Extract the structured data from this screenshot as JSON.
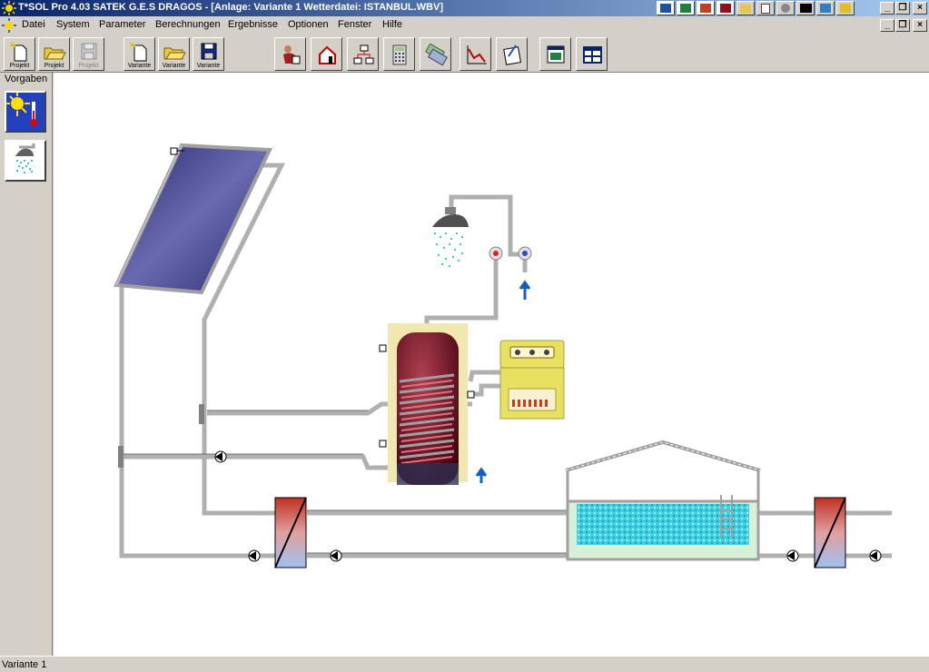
{
  "window": {
    "title": "T*SOL Pro 4.03 SATEK G.E.S DRAGOS - [Anlage: Variante 1    Wetterdatei: ISTANBUL.WBV]"
  },
  "menu": [
    {
      "label": "Datei"
    },
    {
      "label": "System"
    },
    {
      "label": "Parameter"
    },
    {
      "label": "Berechnungen"
    },
    {
      "label": "Ergebnisse"
    },
    {
      "label": "Optionen"
    },
    {
      "label": "Fenster"
    },
    {
      "label": "Hilfe"
    }
  ],
  "toolbar": {
    "new_project": "Projekt",
    "open_project": "Projekt",
    "save_project": "Projekt",
    "new_variant": "Variante",
    "open_variant": "Variante",
    "save_variant": "Variante"
  },
  "sidepanel": {
    "title": "Vorgaben"
  },
  "status": {
    "text": "Variante 1"
  },
  "icons": {
    "tray": [
      "word-icon",
      "excel-icon",
      "powerpoint-icon",
      "access-icon",
      "folder-icon",
      "file-icon",
      "settings-icon",
      "terminal-icon",
      "image-icon",
      "tools-icon"
    ],
    "toolbar_tools": [
      "person-icon",
      "house-icon",
      "network-icon",
      "calculator-icon",
      "money-icon",
      "chart-icon",
      "report-icon",
      "window-icon",
      "table-icon"
    ]
  },
  "colors": {
    "title_start": "#0a246a",
    "title_end": "#a6caf0",
    "pipe": "#a0a0a0",
    "collector": "#3c3c8c",
    "tank": "#7a1a2a",
    "pool_water": "#40d0e0",
    "controller": "#e8e060",
    "arrow": "#1060c0"
  }
}
